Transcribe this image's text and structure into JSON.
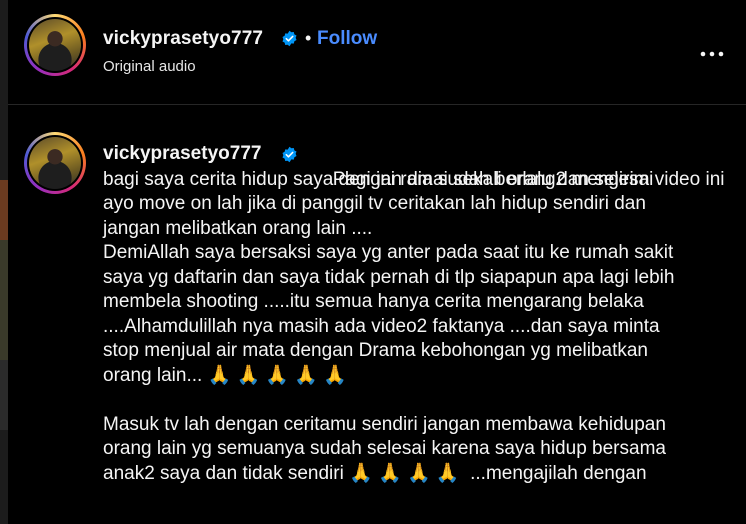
{
  "post": {
    "username": "vickyprasetyo777",
    "separator": "•",
    "follow_label": "Follow",
    "audio_label": "Original audio",
    "more_label": "•••"
  },
  "caption": {
    "username": "vickyprasetyo777",
    "lines": [
      "Pagi ini ramai sekali orang2 mengirim video ini",
      "bagi saya cerita hidup saya dengan dia sudah berlalu dan selesai",
      "ayo move on lah jika di panggil tv ceritakan lah hidup sendiri dan",
      "jangan melibatkan orang lain ....",
      "DemiAllah saya bersaksi saya yg anter pada saat itu ke rumah sakit",
      "saya yg daftarin dan saya tidak pernah di tlp siapapun apa lagi lebih",
      "membela shooting .....itu semua hanya cerita mengarang belaka",
      "....Alhamdulillah nya masih ada video2 faktanya ....dan saya minta",
      "stop menjual air mata dengan Drama kebohongan yg melibatkan",
      "orang lain... 🙏 🙏 🙏 🙏 🙏",
      "",
      "Masuk tv lah dengan ceritamu sendiri jangan membawa kehidupan",
      "orang lain yg semuanya sudah selesai karena saya hidup bersama",
      "anak2 saya dan tidak sendiri 🙏 🙏 🙏 🙏  ...mengajilah dengan"
    ]
  },
  "colors": {
    "background": "#000000",
    "follow": "#4a8cff",
    "verified_badge": "#0095f6",
    "divider": "#262626"
  },
  "icons": {
    "verified": "verified-badge-icon",
    "more": "more-options-icon",
    "avatar": "profile-avatar"
  }
}
